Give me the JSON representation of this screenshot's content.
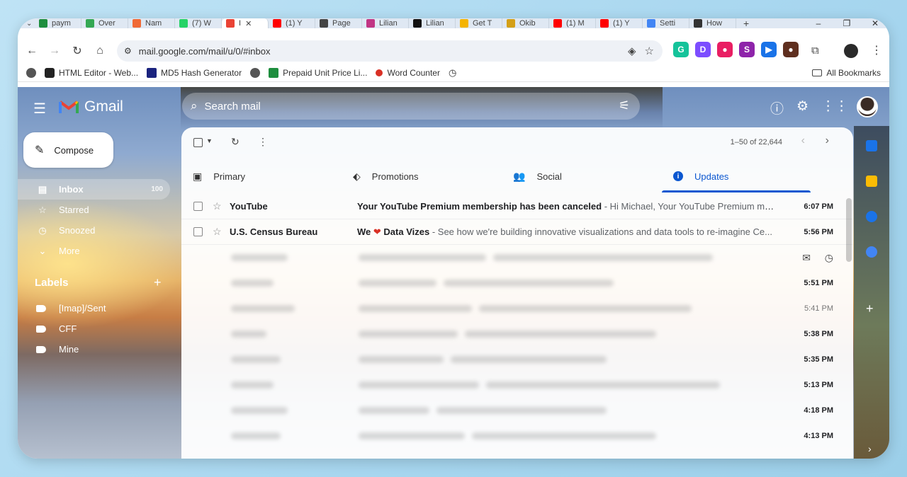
{
  "browser": {
    "tabs": [
      {
        "label": "paym",
        "color": "#1e8e3e"
      },
      {
        "label": "Over",
        "color": "#34a853"
      },
      {
        "label": "Nam",
        "color": "#f06a35"
      },
      {
        "label": "(7) W",
        "color": "#25d366"
      },
      {
        "label": "I",
        "color": "#ea4335",
        "active": true
      },
      {
        "label": "(1) Y",
        "color": "#ff0000"
      },
      {
        "label": "Page",
        "color": "#444444"
      },
      {
        "label": "Lilian",
        "color": "#c13584"
      },
      {
        "label": "Lilian",
        "color": "#111111"
      },
      {
        "label": "Get T",
        "color": "#f4b400"
      },
      {
        "label": "Okib",
        "color": "#d4a017"
      },
      {
        "label": "(1) M",
        "color": "#ff0000"
      },
      {
        "label": "(1) Y",
        "color": "#ff0000"
      },
      {
        "label": "Setti",
        "color": "#4285f4"
      },
      {
        "label": "How",
        "color": "#333333"
      }
    ],
    "new_tab": "+",
    "url": "mail.google.com/mail/u/0/#inbox",
    "bookmarks": [
      "HTML Editor - Web...",
      "MD5 Hash Generator",
      "Prepaid Unit Price Li...",
      "Word Counter"
    ],
    "all_bookmarks": "All Bookmarks",
    "extensions": [
      {
        "glyph": "G",
        "color": "#15c39a"
      },
      {
        "glyph": "D",
        "color": "#7c4dff"
      },
      {
        "glyph": "●",
        "color": "#e91e63"
      },
      {
        "glyph": "S",
        "color": "#8e24aa"
      },
      {
        "glyph": "▶",
        "color": "#1a73e8"
      },
      {
        "glyph": "●",
        "color": "#5f2f1f"
      }
    ]
  },
  "gmail": {
    "brand": "Gmail",
    "search_placeholder": "Search mail",
    "compose": "Compose",
    "nav": [
      {
        "label": "Inbox",
        "count": "100",
        "active": true,
        "icon": "inbox-icon"
      },
      {
        "label": "Starred",
        "icon": "star-icon"
      },
      {
        "label": "Snoozed",
        "icon": "clock-icon"
      },
      {
        "label": "More",
        "icon": "chevron-down-icon"
      }
    ],
    "labels_title": "Labels",
    "labels": [
      "[Imap]/Sent",
      "CFF",
      "Mine"
    ],
    "pager": "1–50 of 22,644",
    "tabs": [
      {
        "label": "Primary",
        "icon": "inbox-tab-icon"
      },
      {
        "label": "Promotions",
        "icon": "tag-icon"
      },
      {
        "label": "Social",
        "icon": "people-icon"
      },
      {
        "label": "Updates",
        "icon": "info-icon",
        "active": true
      }
    ],
    "emails": [
      {
        "sender": "YouTube",
        "subject": "Your YouTube Premium membership has been canceled",
        "snippet": " - Hi Michael, Your YouTube Premium mem...",
        "time": "6:07 PM"
      },
      {
        "sender": "U.S. Census Bureau",
        "subject_pre": "We ",
        "subject_post": " Data Vizes",
        "snippet": " - See how we're building innovative visualizations and data tools to re-imagine Ce...",
        "time": "5:56 PM"
      }
    ],
    "blurred_times": [
      "",
      "5:51 PM",
      "5:41 PM",
      "5:38 PM",
      "5:35 PM",
      "5:13 PM",
      "4:18 PM",
      "4:13 PM"
    ]
  }
}
